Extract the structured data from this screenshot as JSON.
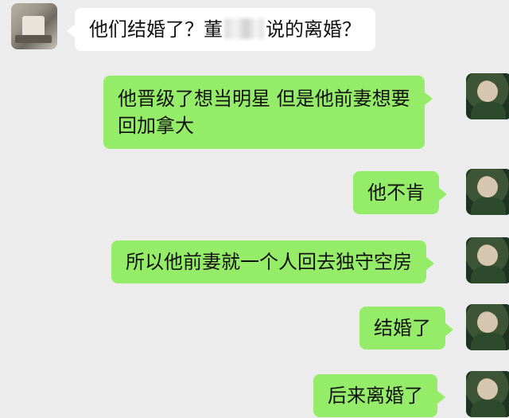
{
  "messages": [
    {
      "side": "left",
      "text_before": "他们结婚了？董",
      "text_after": "说的离婚？"
    },
    {
      "side": "right",
      "line1": "他晋级了想当明星 但是他前妻想要",
      "line2": "回加拿大"
    },
    {
      "side": "right",
      "text": "他不肯"
    },
    {
      "side": "right",
      "text": "所以他前妻就一个人回去独守空房"
    },
    {
      "side": "right",
      "text": "结婚了"
    },
    {
      "side": "right",
      "text": "后来离婚了"
    }
  ],
  "colors": {
    "background": "#ececec",
    "incoming": "#ffffff",
    "outgoing": "#95ec69"
  }
}
